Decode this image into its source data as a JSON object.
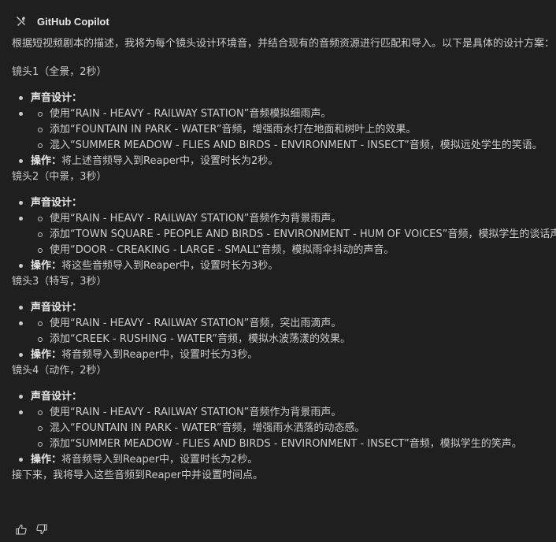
{
  "header": {
    "title": "GitHub Copilot",
    "logo_icon": "copilot-tools-icon"
  },
  "message": {
    "intro": "根据短视频剧本的描述，我将为每个镜头设计环境音，并结合现有的音频资源进行匹配和导入。以下是具体的设计方案：",
    "shots": [
      {
        "title": "镜头1（全景，2秒）",
        "design_label": "声音设计",
        "sound_items": [
          "使用“RAIN - HEAVY - RAILWAY STATION”音频模拟细雨声。",
          "添加“FOUNTAIN IN PARK - WATER”音频，增强雨水打在地面和树叶上的效果。",
          "混入“SUMMER MEADOW - FLIES AND BIRDS - ENVIRONMENT - INSECT”音频，模拟远处学生的笑语。"
        ],
        "operation_label": "操作",
        "operation_text": "将上述音频导入到Reaper中，设置时长为2秒。"
      },
      {
        "title": "镜头2（中景，3秒）",
        "design_label": "声音设计",
        "sound_items": [
          "使用“RAIN - HEAVY - RAILWAY STATION”音频作为背景雨声。",
          "添加“TOWN SQUARE - PEOPLE AND BIRDS - ENVIRONMENT - HUM OF VOICES”音频，模拟学生的谈话声。",
          "使用“DOOR - CREAKING - LARGE - SMALL”音频，模拟雨伞抖动的声音。"
        ],
        "operation_label": "操作",
        "operation_text": "将这些音频导入到Reaper中，设置时长为3秒。"
      },
      {
        "title": "镜头3（特写，3秒）",
        "design_label": "声音设计",
        "sound_items": [
          "使用“RAIN - HEAVY - RAILWAY STATION”音频，突出雨滴声。",
          "添加“CREEK - RUSHING - WATER”音频，模拟水波荡漾的效果。"
        ],
        "operation_label": "操作",
        "operation_text": "将音频导入到Reaper中，设置时长为3秒。"
      },
      {
        "title": "镜头4（动作，2秒）",
        "design_label": "声音设计",
        "sound_items": [
          "使用“RAIN - HEAVY - RAILWAY STATION”音频作为背景雨声。",
          "混入“FOUNTAIN IN PARK - WATER”音频，增强雨水洒落的动态感。",
          "添加“SUMMER MEADOW - FLIES AND BIRDS - ENVIRONMENT - INSECT”音频，模拟学生的笑声。"
        ],
        "operation_label": "操作",
        "operation_text": "将音频导入到Reaper中，设置时长为2秒。"
      }
    ],
    "outro": "接下来，我将导入这些音频到Reaper中并设置时间点。"
  },
  "actions": {
    "thumbs_up_icon": "thumbs-up-icon",
    "thumbs_down_icon": "thumbs-down-icon"
  },
  "colors": {
    "background": "#1f1f1f",
    "text": "#cccccc",
    "strong_text": "#e6e6e6"
  }
}
